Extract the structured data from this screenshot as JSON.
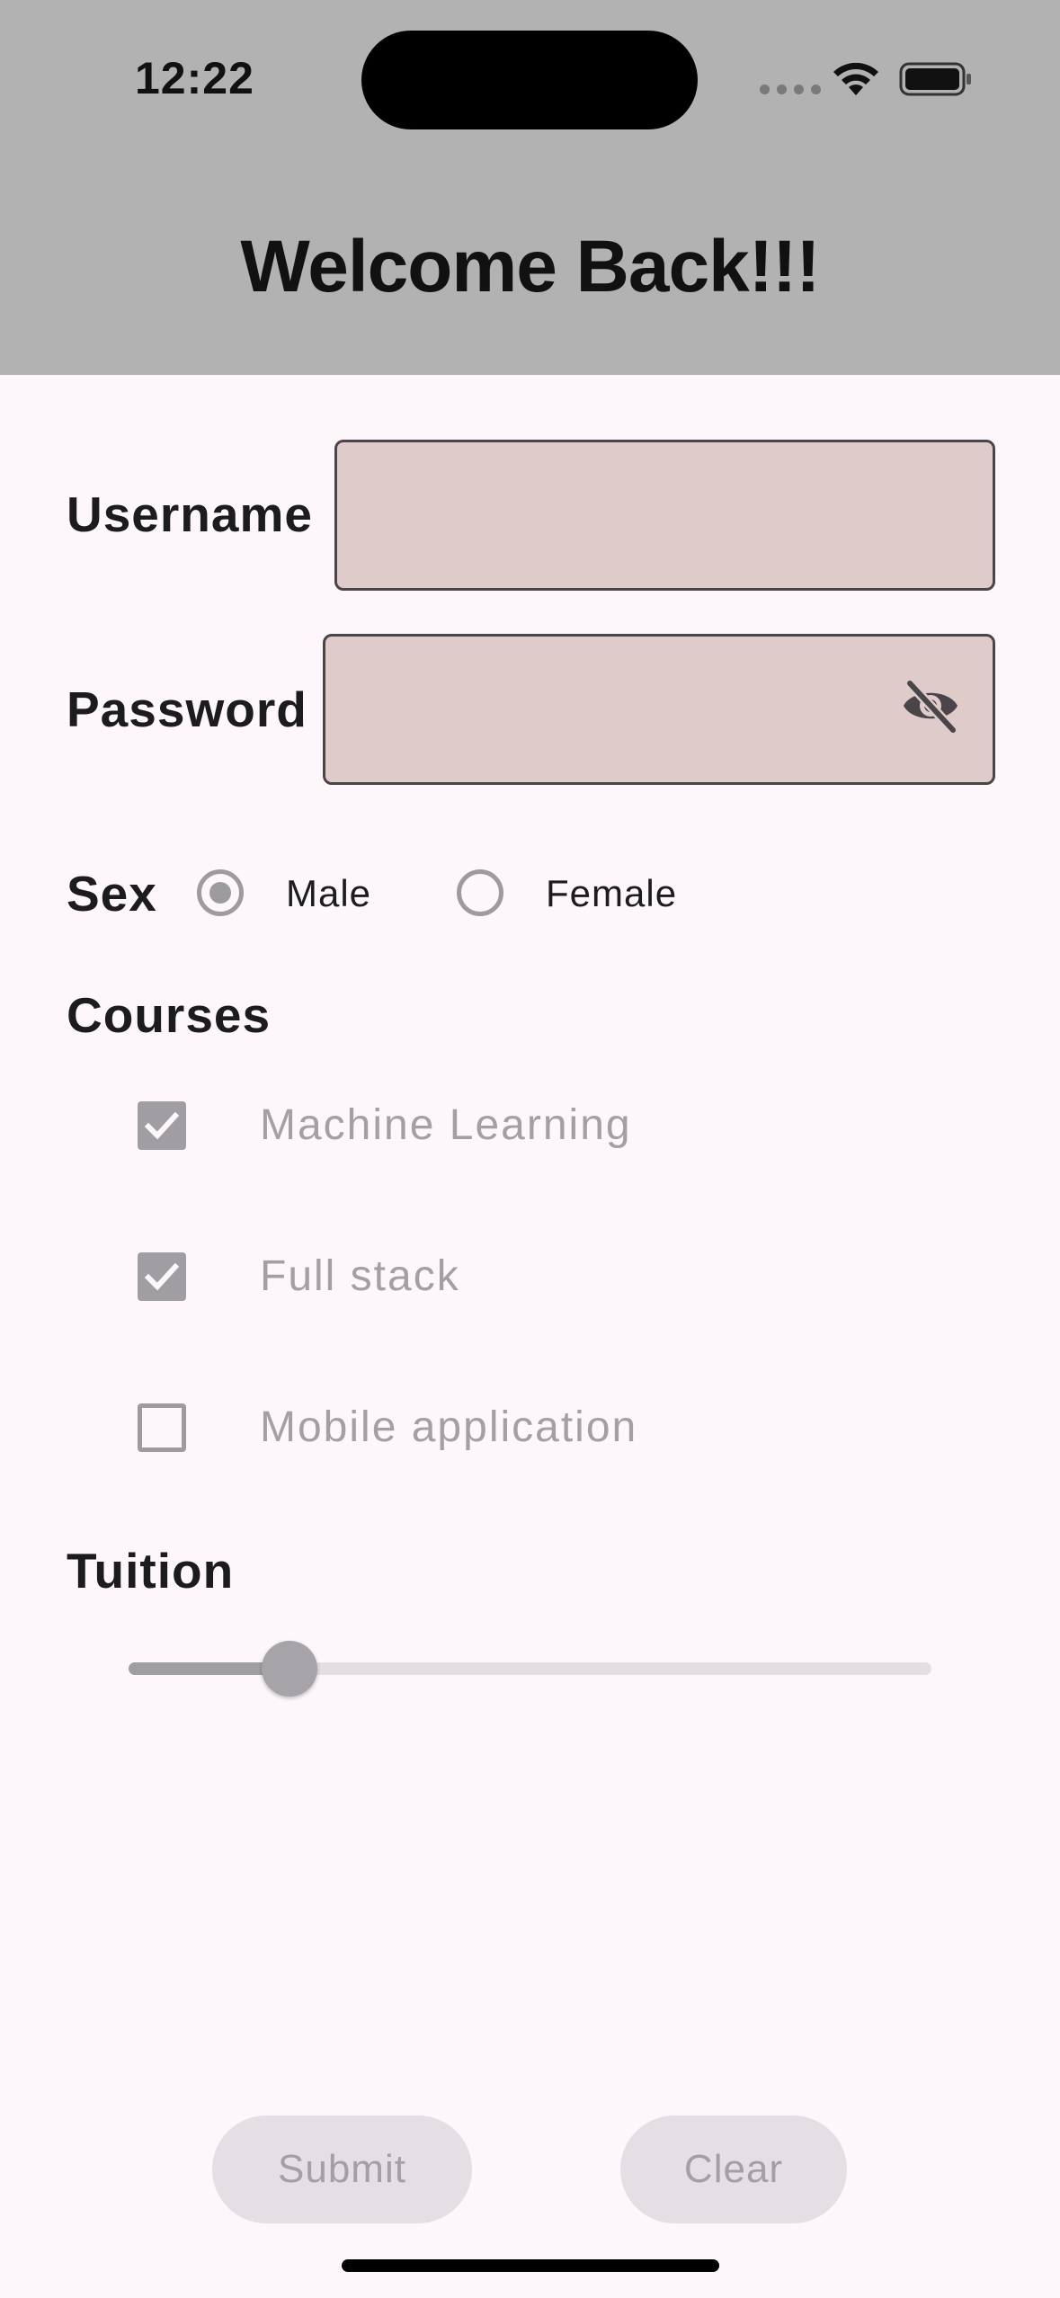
{
  "status_bar": {
    "time": "12:22"
  },
  "header": {
    "title": "Welcome Back!!!"
  },
  "form": {
    "username_label": "Username",
    "username_value": "",
    "password_label": "Password",
    "password_value": "",
    "password_toggle_icon": "eye-off-icon",
    "sex": {
      "label": "Sex",
      "options": [
        {
          "label": "Male",
          "selected": true
        },
        {
          "label": "Female",
          "selected": false
        }
      ]
    },
    "courses": {
      "label": "Courses",
      "items": [
        {
          "label": "Machine Learning",
          "checked": true
        },
        {
          "label": "Full stack",
          "checked": true
        },
        {
          "label": "Mobile application",
          "checked": false
        }
      ]
    },
    "tuition": {
      "label": "Tuition",
      "value_fraction": 0.2
    }
  },
  "actions": {
    "submit_label": "Submit",
    "clear_label": "Clear"
  },
  "colors": {
    "header_bg": "#B2B2B2",
    "page_bg": "#FDF7FC",
    "field_bg": "#E0CBCB",
    "disabled_text": "#A39FA5"
  }
}
